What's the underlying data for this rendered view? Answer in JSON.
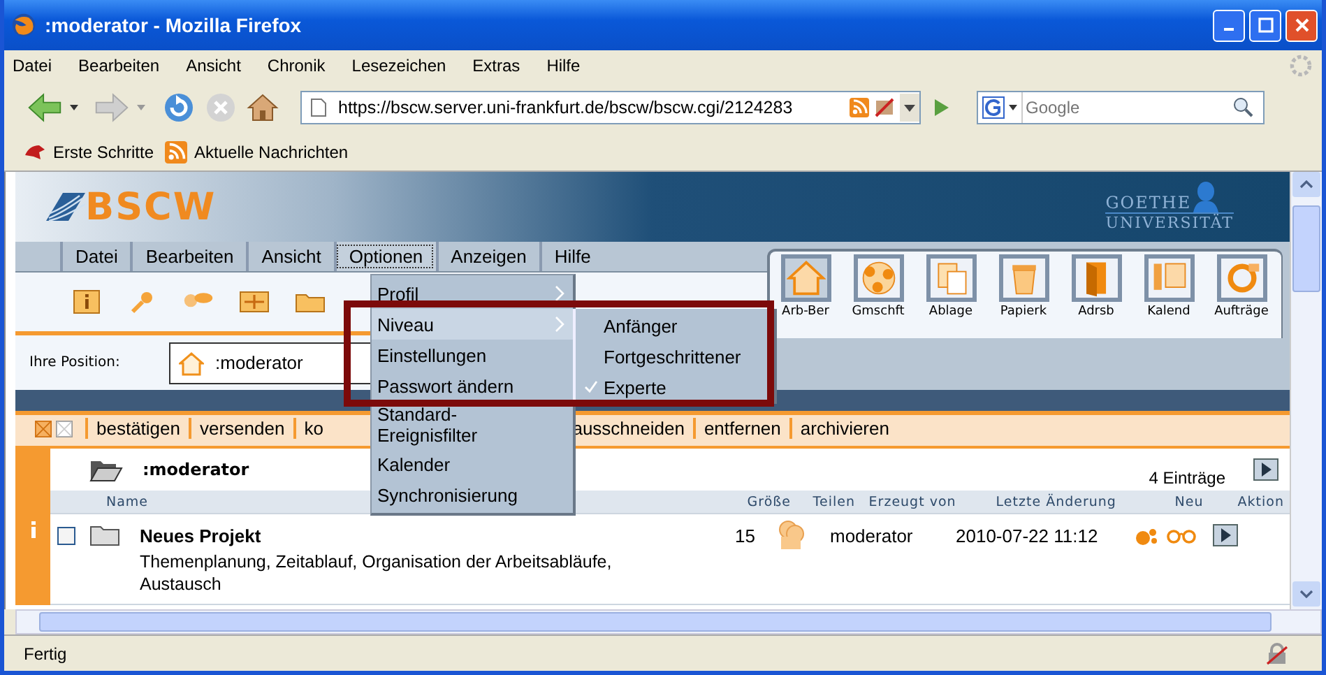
{
  "window": {
    "title": ":moderator - Mozilla Firefox"
  },
  "menubar": [
    "Datei",
    "Bearbeiten",
    "Ansicht",
    "Chronik",
    "Lesezeichen",
    "Extras",
    "Hilfe"
  ],
  "navigation": {
    "url": "https://bscw.server.uni-frankfurt.de/bscw/bscw.cgi/2124283",
    "search_placeholder": "Google"
  },
  "bookmarks": [
    "Erste Schritte",
    "Aktuelle Nachrichten"
  ],
  "app": {
    "logo": "BSCW",
    "university": [
      "GOETHE",
      "UNIVERSITÄT"
    ],
    "menu": [
      {
        "label": "Datei",
        "selected": false
      },
      {
        "label": "Bearbeiten",
        "selected": false
      },
      {
        "label": "Ansicht",
        "selected": false
      },
      {
        "label": "Optionen",
        "selected": true
      },
      {
        "label": "Anzeigen",
        "selected": false
      },
      {
        "label": "Hilfe",
        "selected": false
      }
    ],
    "shortcuts": [
      {
        "label": "Arb-Ber",
        "selected": true
      },
      {
        "label": "Gmschft",
        "selected": false
      },
      {
        "label": "Ablage",
        "selected": false
      },
      {
        "label": "Papierk",
        "selected": false
      },
      {
        "label": "Adrsb",
        "selected": false
      },
      {
        "label": "Kalend",
        "selected": false
      },
      {
        "label": "Aufträge",
        "selected": false
      }
    ],
    "position": {
      "label": "Ihre Position:",
      "value": ":moderator"
    },
    "actions": [
      "bestätigen",
      "versenden",
      "ko",
      "ausschneiden",
      "entfernen",
      "archivieren"
    ],
    "folder": {
      "name": ":moderator",
      "count": "4 Einträge"
    },
    "columns": [
      "Name",
      "Größe",
      "Teilen",
      "Erzeugt von",
      "Letzte Änderung",
      "Neu",
      "Aktion"
    ],
    "rows": [
      {
        "name": "Neues Projekt",
        "description": "Themenplanung, Zeitablauf, Organisation der Arbeitsabläufe, Austausch",
        "size": "15",
        "creator": "moderator",
        "modified": "2010-07-22 11:12",
        "checked": false
      }
    ],
    "dropdown": {
      "items": [
        {
          "label": "Profil",
          "submenu": true,
          "selected": false
        },
        {
          "label": "Niveau",
          "submenu": true,
          "selected": true
        },
        {
          "label": "Einstellungen",
          "submenu": false,
          "selected": false
        },
        {
          "label": "Passwort ändern",
          "submenu": false,
          "selected": false
        },
        {
          "label": "Standard-Ereignisfilter",
          "submenu": false,
          "selected": false
        },
        {
          "label": "Kalender",
          "submenu": false,
          "selected": false
        },
        {
          "label": "Synchronisierung",
          "submenu": false,
          "selected": false
        }
      ],
      "submenu": [
        {
          "label": "Anfänger",
          "checked": false
        },
        {
          "label": "Fortgeschrittener",
          "checked": false
        },
        {
          "label": "Experte",
          "checked": true
        }
      ]
    }
  },
  "status_bar": {
    "text": "Fertig"
  }
}
